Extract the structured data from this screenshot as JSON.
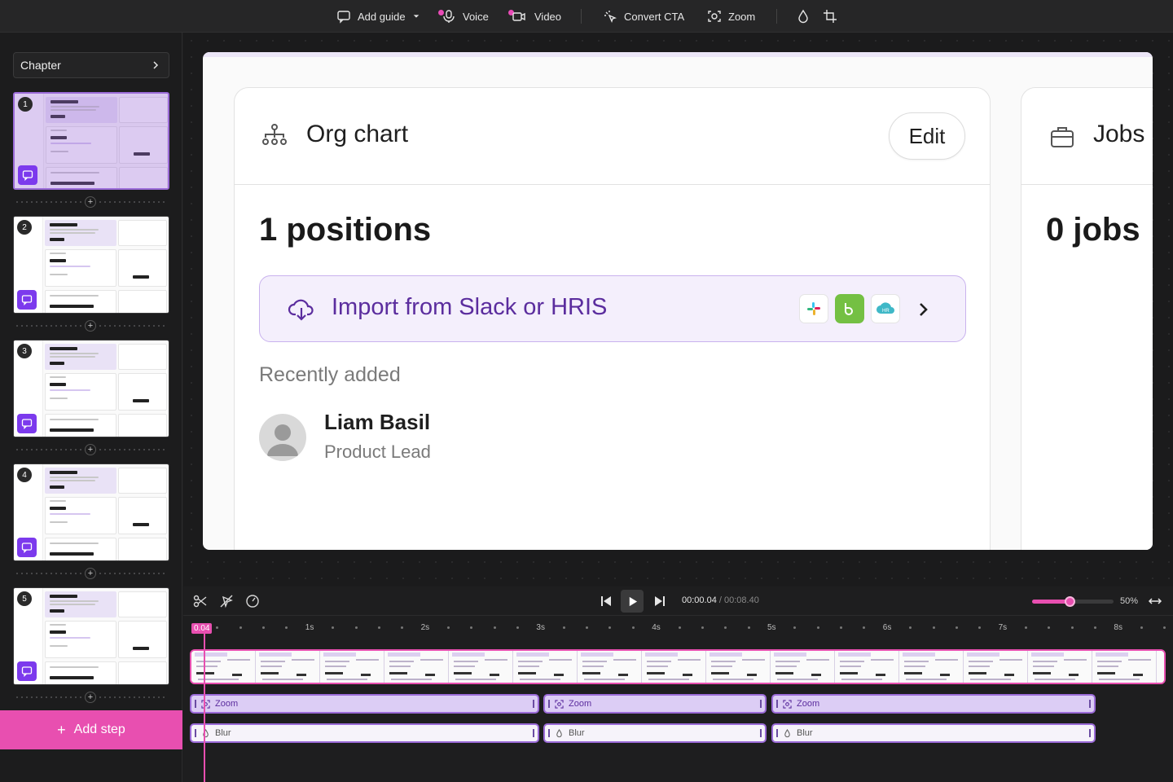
{
  "toolbar": {
    "add_guide": "Add guide",
    "voice": "Voice",
    "video": "Video",
    "convert_cta": "Convert CTA",
    "zoom": "Zoom"
  },
  "sidebar": {
    "chapter": "Chapter",
    "steps": [
      {
        "num": "1"
      },
      {
        "num": "2"
      },
      {
        "num": "3"
      },
      {
        "num": "4"
      },
      {
        "num": "5"
      }
    ],
    "add_step": "Add step"
  },
  "canvas": {
    "org_chart": {
      "title": "Org chart",
      "edit": "Edit",
      "positions": "1 positions",
      "import_label": "Import from Slack or HRIS",
      "recently_added": "Recently added",
      "person": {
        "name": "Liam Basil",
        "role": "Product Lead"
      }
    },
    "jobs": {
      "title": "Jobs",
      "count": "0 jobs"
    }
  },
  "player": {
    "current": "00:00.04",
    "separator": " / ",
    "total": "00:08.40",
    "zoom_level": 0.46,
    "zoom_pct": "50%"
  },
  "timeline": {
    "playhead": "0.04",
    "ticks": [
      "1s",
      "2s",
      "3s",
      "4s",
      "5s",
      "6s",
      "7s",
      "8s"
    ],
    "zoom_segments": [
      "Zoom",
      "Zoom",
      "Zoom"
    ],
    "blur_segments": [
      "Blur",
      "Blur",
      "Blur"
    ]
  },
  "colors": {
    "accent": "#e84fb0",
    "purple": "#7c3aed",
    "import_text": "#5b2d9e"
  }
}
